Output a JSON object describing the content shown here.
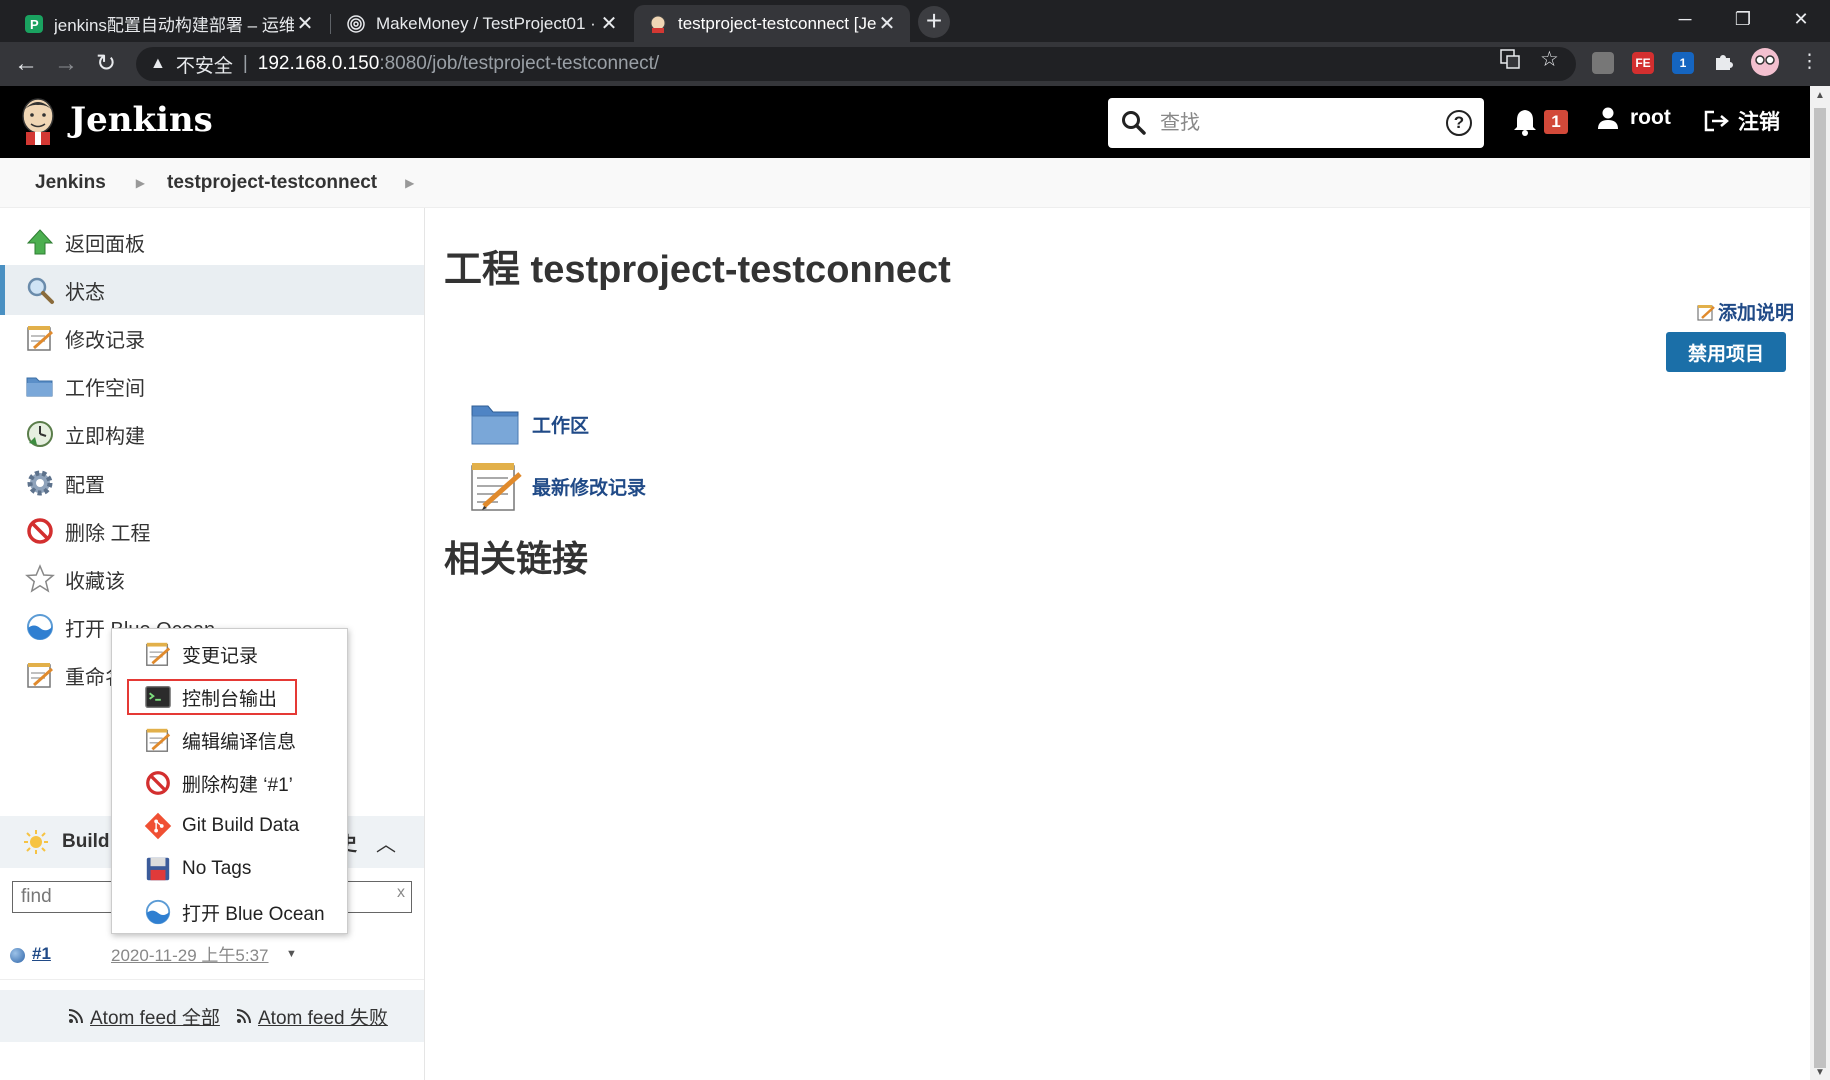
{
  "browser": {
    "tabs": [
      {
        "title": "jenkins配置自动构建部署 – 运维",
        "close": "✕",
        "active": false
      },
      {
        "title": "MakeMoney / TestProject01 · ",
        "close": "✕",
        "active": false
      },
      {
        "title": "testproject-testconnect [Jenki",
        "close": "✕",
        "active": true
      }
    ],
    "new_tab": "+",
    "address": {
      "security_label": "不安全",
      "separator": "|",
      "host": "192.168.0.150",
      "path": ":8080/job/testproject-testconnect/"
    },
    "extension_labels": {
      "ext2": "FE",
      "ext3": "1"
    }
  },
  "header": {
    "brand": "Jenkins",
    "search_placeholder": "查找",
    "help": "?",
    "notification_count": "1",
    "user": "root",
    "logout": "注销"
  },
  "breadcrumb": {
    "items": [
      "Jenkins",
      "testproject-testconnect"
    ]
  },
  "sidebar": {
    "tasks": [
      {
        "label": "返回面板",
        "icon": "up-arrow-icon"
      },
      {
        "label": "状态",
        "icon": "search-icon"
      },
      {
        "label": "修改记录",
        "icon": "notepad-icon"
      },
      {
        "label": "工作空间",
        "icon": "folder-icon"
      },
      {
        "label": "立即构建",
        "icon": "clock-icon"
      },
      {
        "label": "配置",
        "icon": "gear-icon"
      },
      {
        "label": "删除 工程",
        "icon": "no-entry-icon"
      },
      {
        "label": "收藏该",
        "icon": "star-icon"
      },
      {
        "label": "打开 Blue Ocean",
        "icon": "blue-ocean-icon"
      },
      {
        "label": "重命名",
        "icon": "notepad-icon"
      }
    ],
    "build_history": {
      "title": "Build",
      "title_suffix": "史",
      "filter_placeholder": "find",
      "filter_clear": "x",
      "builds": [
        {
          "number": "#1",
          "date": "2020-11-29 上午5:37"
        }
      ],
      "feeds": [
        {
          "label": "Atom feed 全部"
        },
        {
          "label": "Atom feed 失败"
        }
      ]
    }
  },
  "context_menu": {
    "items": [
      {
        "label": "变更记录",
        "icon": "notepad-icon"
      },
      {
        "label": "控制台输出",
        "icon": "terminal-icon"
      },
      {
        "label": "编辑编译信息",
        "icon": "notepad-icon"
      },
      {
        "label": "删除构建 ‘#1’",
        "icon": "no-entry-icon"
      },
      {
        "label": "Git Build Data",
        "icon": "git-icon"
      },
      {
        "label": "No Tags",
        "icon": "save-icon"
      },
      {
        "label": "打开 Blue Ocean",
        "icon": "blue-ocean-icon"
      }
    ],
    "highlighted": "控制台输出"
  },
  "main": {
    "title": "工程 testproject-testconnect",
    "add_description": "添加说明",
    "disable_button": "禁用项目",
    "links": [
      {
        "label": "工作区",
        "icon": "folder-icon"
      },
      {
        "label": "最新修改记录",
        "icon": "notepad-icon"
      }
    ],
    "related_heading": "相关链接"
  },
  "colors": {
    "jenkins_header": "#000000",
    "link_blue": "#204a87",
    "button_blue": "#1b6fa8",
    "badge_red": "#d24939",
    "highlight_red": "#e53935"
  }
}
